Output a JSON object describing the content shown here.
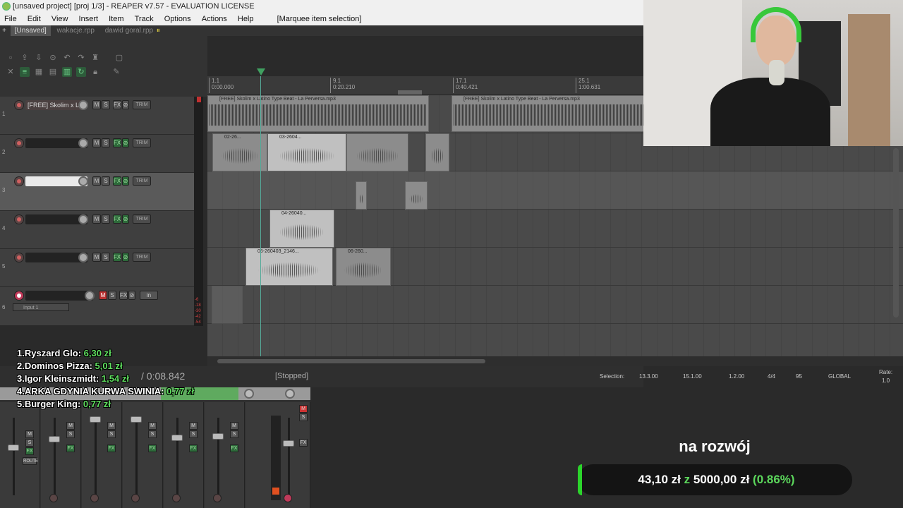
{
  "window": {
    "title": "[unsaved project] [proj 1/3] - REAPER v7.57 - EVALUATION LICENSE"
  },
  "menu": {
    "items": [
      "File",
      "Edit",
      "View",
      "Insert",
      "Item",
      "Track",
      "Options",
      "Actions",
      "Help"
    ],
    "hint": "[Marquee item selection]"
  },
  "project_tabs": [
    {
      "label": "[Unsaved]",
      "active": true
    },
    {
      "label": "wakacje.rpp",
      "active": false
    },
    {
      "label": "dawid goral.rpp",
      "active": false
    }
  ],
  "ruler": {
    "marks": [
      {
        "bar": "1.1",
        "time": "0:00.000"
      },
      {
        "bar": "9.1",
        "time": "0:20.210"
      },
      {
        "bar": "17.1",
        "time": "0:40.421"
      },
      {
        "bar": "25.1",
        "time": "1:00.631"
      }
    ]
  },
  "tracks": [
    {
      "num": "1",
      "name": "[FREE] Skolim x La",
      "selected": false,
      "armed": false
    },
    {
      "num": "2",
      "name": "",
      "selected": false,
      "armed": false
    },
    {
      "num": "3",
      "name": "",
      "selected": true,
      "armed": false
    },
    {
      "num": "4",
      "name": "",
      "selected": false,
      "armed": false
    },
    {
      "num": "5",
      "name": "",
      "selected": false,
      "armed": false
    },
    {
      "num": "6",
      "name": "",
      "selected": false,
      "armed": true,
      "input": "Input 1"
    }
  ],
  "tcp_buttons": {
    "mute": "M",
    "solo": "S",
    "fx": "FX",
    "trim": "TRIM",
    "in": "in"
  },
  "items": {
    "beat_a": "[FREE] Skolim x Latino Type Beat - La Perversa.mp3",
    "beat_b": "[FREE] Skolim x Latino Type Beat - La Perversa.mp3",
    "t2_a": "02-26...",
    "t2_b": "03-2604...",
    "t4_a": "04-26040...",
    "t5_a": "05-260403_2146...",
    "t5_b": "06-260..."
  },
  "vu_labels": [
    "-6",
    "-18",
    "-30",
    "-42",
    "-54"
  ],
  "transport": {
    "time": "/ 0:08.842",
    "status": "[Stopped]",
    "selection_label": "Selection:",
    "sel_start": "13.3.00",
    "sel_end": "15.1.00",
    "sel_len": "1.2.00",
    "timesig": "4/4",
    "bpm": "95",
    "global": "GLOBAL",
    "rate_label": "Rate:",
    "rate": "1.0"
  },
  "mixer": {
    "master_label": "ROUTE",
    "strip_labels": [
      "M",
      "S",
      "FX"
    ]
  },
  "donors": [
    {
      "rank": "1.",
      "name": "Ryszard Glo:",
      "amount": "6,30 zł"
    },
    {
      "rank": "2.",
      "name": "Dominos Pizza:",
      "amount": "5,01 zł"
    },
    {
      "rank": "3.",
      "name": "Igor Kleinszmidt:",
      "amount": "1,54 zł"
    },
    {
      "rank": "4.",
      "name": "ARKA GDYNIA KURWA SWINIA:",
      "amount": "0,77 zł"
    },
    {
      "rank": "5.",
      "name": "Burger King:",
      "amount": "0,77 zł"
    }
  ],
  "goal": {
    "title": "na rozwój",
    "raised": "43,10 zł",
    "of": "z",
    "target": "5000,00 zł",
    "percent_text": "(0.86%)",
    "fraction": 0.0086
  },
  "colors": {
    "accent_green": "#2bd42b",
    "record_red": "#c03a5a"
  }
}
